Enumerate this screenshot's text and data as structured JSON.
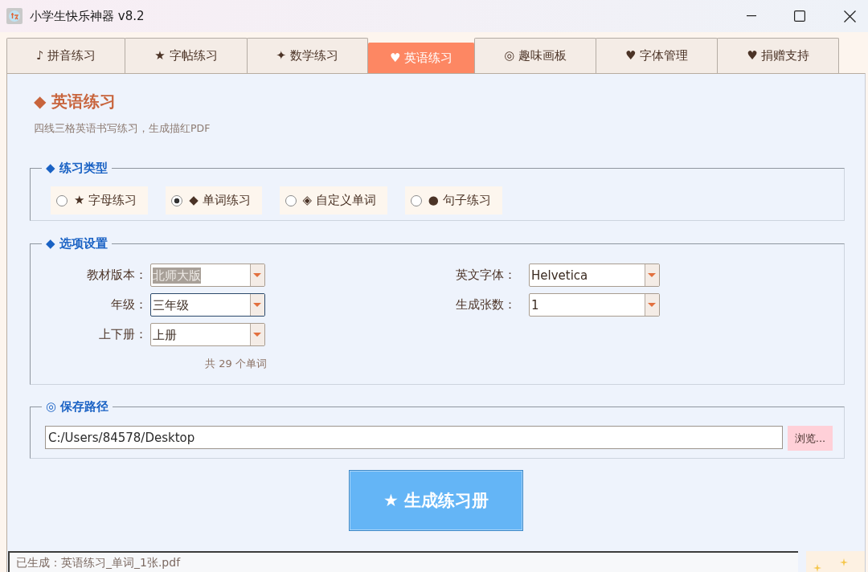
{
  "window": {
    "title": "小学生快乐神器 v8.2"
  },
  "tabs": [
    {
      "label": "♪ 拼音练习",
      "selected": false
    },
    {
      "label": "★ 字帖练习",
      "selected": false
    },
    {
      "label": "✦ 数学练习",
      "selected": false
    },
    {
      "label": "♥ 英语练习",
      "selected": true
    },
    {
      "label": "◎ 趣味画板",
      "selected": false
    },
    {
      "label": "♥ 字体管理",
      "selected": false
    },
    {
      "label": "♥ 捐赠支持",
      "selected": false
    }
  ],
  "page": {
    "title": "◆ 英语练习",
    "subtitle": "四线三格英语书写练习，生成描红PDF"
  },
  "practice_type": {
    "legend": "◆ 练习类型",
    "options": [
      {
        "label": "★ 字母练习",
        "selected": false
      },
      {
        "label": "◆ 单词练习",
        "selected": true
      },
      {
        "label": "◈ 自定义单词",
        "selected": false
      },
      {
        "label": "● 句子练习",
        "selected": false
      }
    ]
  },
  "options": {
    "legend": "◆ 选项设置",
    "left_fields": [
      {
        "label": "教材版本：",
        "value": "北师大版",
        "focused": false,
        "text_selected": true
      },
      {
        "label": "年级：",
        "value": "三年级",
        "focused": true,
        "text_selected": false
      },
      {
        "label": "上下册：",
        "value": "上册",
        "focused": false,
        "text_selected": false
      }
    ],
    "right_fields": [
      {
        "label": "英文字体：",
        "value": "Helvetica",
        "focused": false,
        "text_selected": false
      },
      {
        "label": "生成张数：",
        "value": "1",
        "focused": false,
        "text_selected": false
      }
    ],
    "word_count": "共 29 个单词"
  },
  "save_path": {
    "legend": "◎ 保存路径",
    "value": "C:/Users/84578/Desktop",
    "browse_button": "浏览..."
  },
  "generate_button": "★ 生成练习册",
  "status_bar": {
    "text": "已生成：英语练习_单词_1张.pdf"
  }
}
